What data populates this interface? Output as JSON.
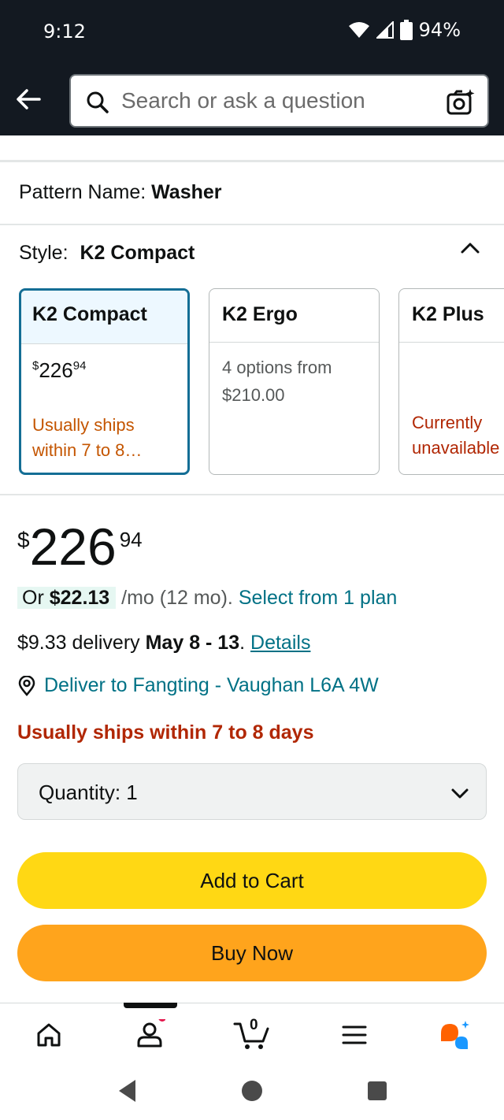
{
  "status_bar": {
    "time": "9:12",
    "battery": "94%"
  },
  "header": {
    "search_placeholder": "Search or ask a question"
  },
  "pattern": {
    "label": "Pattern Name:",
    "value": "Washer"
  },
  "style": {
    "label": "Style:",
    "value": "K2 Compact",
    "options": [
      {
        "name": "K2 Compact",
        "price_currency": "$",
        "price_whole": "226",
        "price_fraction": "94",
        "availability": [
          "Usually ships",
          "within 7 to 8…"
        ],
        "selected": true
      },
      {
        "name": "K2 Ergo",
        "options_text": [
          "4 options from",
          "$210.00"
        ],
        "selected": false
      },
      {
        "name": "K2 Plus",
        "availability": [
          "Currently",
          "unavailable"
        ],
        "selected": false
      }
    ]
  },
  "price": {
    "currency": "$",
    "whole": "226",
    "fraction": "94"
  },
  "installment": {
    "prefix": "Or",
    "amount": "$22.13",
    "term": "/mo (12 mo).",
    "link": "Select from 1 plan"
  },
  "delivery": {
    "cost": "$9.33 delivery",
    "dates": "May 8 - 13",
    "separator": ".",
    "details_link": "Details"
  },
  "deliver_to": {
    "text": "Deliver to Fangting - Vaughan L6A 4W"
  },
  "shipping_notice": "Usually ships within 7 to 8 days",
  "quantity": {
    "label": "Quantity:",
    "value": "1"
  },
  "buttons": {
    "add_to_cart": "Add to Cart",
    "buy_now": "Buy Now"
  },
  "bottom_nav": {
    "cart_count": "0",
    "icons": [
      "home-icon",
      "account-icon",
      "cart-icon",
      "menu-icon",
      "rufus-assistant-icon"
    ]
  },
  "colors": {
    "header_bg": "#131921",
    "link": "#007185",
    "alert_red": "#b12704",
    "add_to_cart": "#ffd814",
    "buy_now": "#ffa41c",
    "selected_border": "#146e95"
  }
}
